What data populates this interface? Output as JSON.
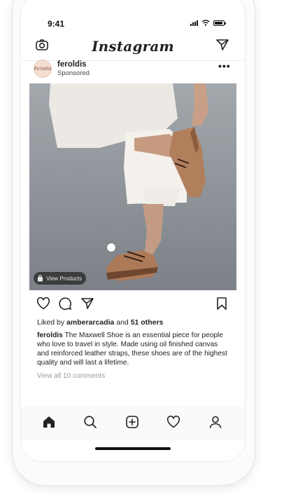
{
  "status_bar": {
    "time": "9:41"
  },
  "app": {
    "title": "Instagram"
  },
  "post": {
    "avatar_text": "Feroldis",
    "username": "feroldis",
    "sponsored_label": "Sponsored",
    "more_label": "•••",
    "view_products_label": "View Products",
    "liked_by_prefix": "Liked by ",
    "liked_by_user": "amberarcadia",
    "liked_by_and": " and ",
    "liked_by_count": "51 others",
    "caption_user": "feroldis",
    "caption_text": " The Maxwell Shoe is an essential piece for people who love to travel in style. Made using oil finished canvas and reinforced leather straps, these shoes are of the highest quality and will last a lifetime.",
    "view_comments": "View all 10 comments"
  },
  "icons": {
    "camera": "camera-icon",
    "direct": "paper-plane-icon",
    "like": "heart-icon",
    "comment": "comment-icon",
    "share": "paper-plane-icon",
    "save": "bookmark-icon",
    "nav": [
      "home-icon",
      "search-icon",
      "plus-square-icon",
      "heart-icon",
      "profile-icon"
    ]
  },
  "colors": {
    "text": "#262626",
    "muted": "#9a9a9a",
    "nav_bg": "#fafafa"
  }
}
